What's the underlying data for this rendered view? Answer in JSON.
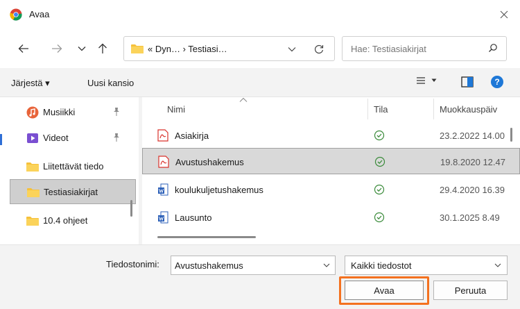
{
  "window": {
    "title": "Avaa"
  },
  "nav": {
    "breadcrumb": "« Dyn…  ›  Testiasi…",
    "search_placeholder": "Hae: Testiasiakirjat"
  },
  "toolbar": {
    "organize_label": "Järjestä ▾",
    "new_folder_label": "Uusi kansio"
  },
  "sidebar": {
    "items": [
      {
        "label": "Musiikki",
        "icon": "music-icon",
        "pinned": true,
        "selected": false
      },
      {
        "label": "Videot",
        "icon": "video-icon",
        "pinned": true,
        "selected": false
      },
      {
        "label": "Liitettävät tiedo",
        "icon": "folder-icon",
        "pinned": false,
        "selected": false
      },
      {
        "label": "Testiasiakirjat",
        "icon": "folder-icon",
        "pinned": false,
        "selected": true
      },
      {
        "label": "10.4 ohjeet",
        "icon": "folder-icon",
        "pinned": false,
        "selected": false
      }
    ]
  },
  "files": {
    "columns": [
      "Nimi",
      "Tila",
      "Muokkauspäiv"
    ],
    "rows": [
      {
        "name": "Asiakirja",
        "type": "pdf",
        "status": "synced",
        "modified": "23.2.2022 14.00",
        "selected": false
      },
      {
        "name": "Avustushakemus",
        "type": "pdf",
        "status": "synced",
        "modified": "19.8.2020 12.47",
        "selected": true
      },
      {
        "name": "koulukuljetushakemus",
        "type": "word",
        "status": "synced",
        "modified": "29.4.2020 16.39",
        "selected": false
      },
      {
        "name": "Lausunto",
        "type": "word",
        "status": "synced",
        "modified": "30.1.2025 8.49",
        "selected": false
      }
    ]
  },
  "bottom": {
    "filename_label": "Tiedostonimi:",
    "filename_value": "Avustushakemus",
    "filetype_value": "Kaikki tiedostot",
    "open_label": "Avaa",
    "cancel_label": "Peruuta"
  },
  "colors": {
    "accent": "#1e78d7",
    "highlight": "#f4711f",
    "folder": "#f6c13b",
    "status_ok": "#3a8b3a",
    "pdf": "#d9312b",
    "word": "#2b5fb8"
  }
}
